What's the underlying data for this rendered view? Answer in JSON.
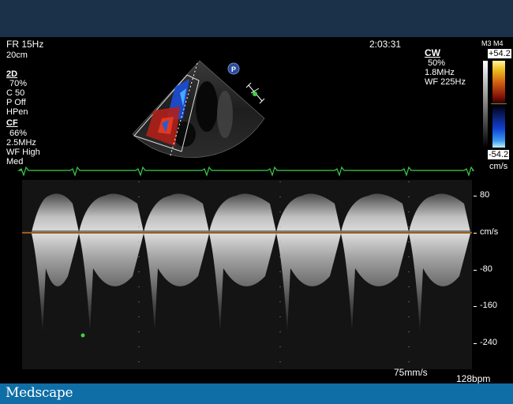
{
  "header": {
    "frame_rate": "FR 15Hz",
    "depth": "20cm",
    "time": "2:03:31"
  },
  "settings_2d": {
    "title": "2D",
    "lines": [
      "70%",
      "C 50",
      "P Off",
      "HPen"
    ]
  },
  "settings_cf": {
    "title": "CF",
    "lines": [
      "66%",
      "2.5MHz",
      "WF High",
      "Med"
    ]
  },
  "settings_cw": {
    "title": "CW",
    "lines": [
      "50%",
      "1.8MHz",
      "WF 225Hz"
    ]
  },
  "colorbar": {
    "label": "M3 M4",
    "max": "+54.2",
    "min": "-54.2",
    "unit": "cm/s"
  },
  "velocity_axis": {
    "unit": "cm/s",
    "ticks": [
      {
        "value": 80,
        "label": "80"
      },
      {
        "value": 0,
        "label": "cm/s"
      },
      {
        "value": -80,
        "label": "-80"
      },
      {
        "value": -160,
        "label": "-160"
      },
      {
        "value": -240,
        "label": "-240"
      }
    ]
  },
  "footer": {
    "sweep_speed": "75mm/s",
    "heart_rate": "128bpm",
    "brand": "Medscape"
  },
  "markers": {
    "probe_marker": "P"
  },
  "colors": {
    "top_bar": "#1b3049",
    "bottom_bar": "#0f6ea6",
    "ecg_trace": "#3ecf4a",
    "baseline": "#f08a1e"
  }
}
